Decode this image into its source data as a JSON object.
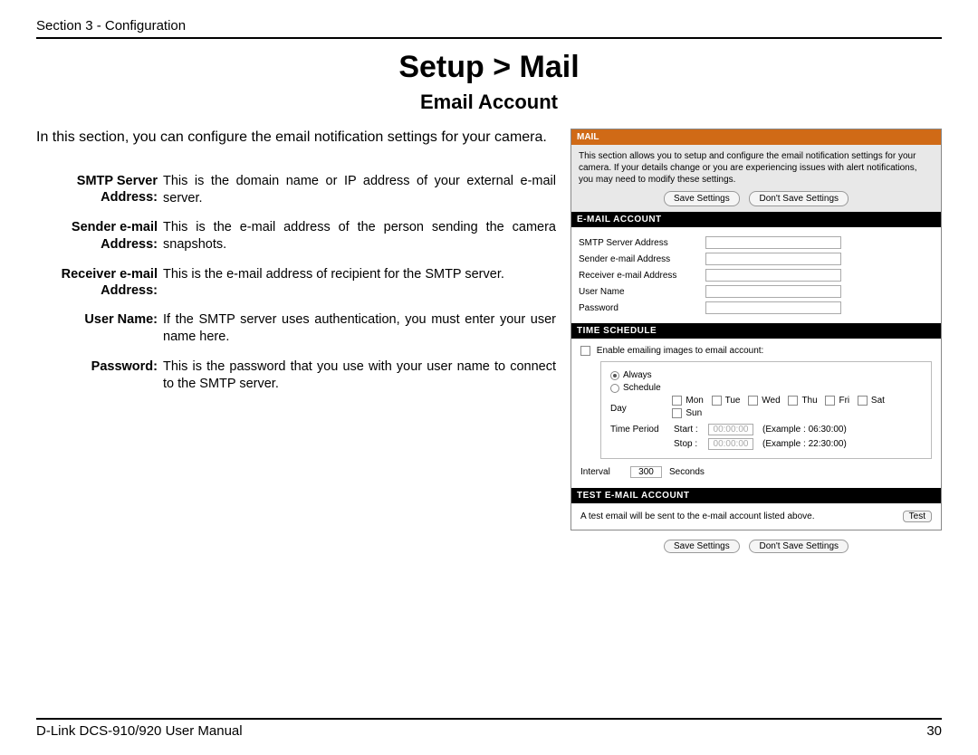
{
  "header": {
    "section_label": "Section 3 - Configuration"
  },
  "title": "Setup > Mail",
  "subtitle": "Email Account",
  "intro": "In this section, you can configure the email notification settings for your camera.",
  "definitions": [
    {
      "term": "SMTP Server Address:",
      "desc": "This is the domain name or IP address of your external e-mail server."
    },
    {
      "term": "Sender e-mail Address:",
      "desc": "This is the e-mail address of the person sending the camera snapshots."
    },
    {
      "term": "Receiver e-mail Address:",
      "desc": "This is the e-mail address of recipient for the SMTP server."
    },
    {
      "term": "User Name:",
      "desc": "If the SMTP server uses authentication, you must enter your user name here."
    },
    {
      "term": "Password:",
      "desc": "This is the password that you use with your user name to connect to the SMTP server."
    }
  ],
  "ui": {
    "mail_head": "MAIL",
    "mail_desc": "This section allows you to setup and configure the email notification settings for your camera. If your details change or you are experiencing issues with alert notifications, you may need to modify these settings.",
    "save": "Save Settings",
    "dont_save": "Don't Save Settings",
    "email_account_head": "E-MAIL ACCOUNT",
    "fields": {
      "smtp": "SMTP Server Address",
      "sender": "Sender e-mail Address",
      "receiver": "Receiver e-mail Address",
      "user": "User Name",
      "pass": "Password"
    },
    "time_schedule_head": "TIME SCHEDULE",
    "enable_label": "Enable emailing images to email account:",
    "always": "Always",
    "schedule": "Schedule",
    "day_label": "Day",
    "days": [
      "Mon",
      "Tue",
      "Wed",
      "Thu",
      "Fri",
      "Sat",
      "Sun"
    ],
    "time_period": "Time Period",
    "start": "Start :",
    "stop": "Stop :",
    "start_val": "00:00:00",
    "stop_val": "00:00:00",
    "ex_start": "(Example : 06:30:00)",
    "ex_stop": "(Example : 22:30:00)",
    "interval": "Interval",
    "interval_val": "300",
    "seconds": "Seconds",
    "test_head": "TEST E-MAIL ACCOUNT",
    "test_desc": "A test email will be sent to the e-mail account listed above.",
    "test_btn": "Test"
  },
  "footer": {
    "manual": "D-Link DCS-910/920 User Manual",
    "page": "30"
  }
}
